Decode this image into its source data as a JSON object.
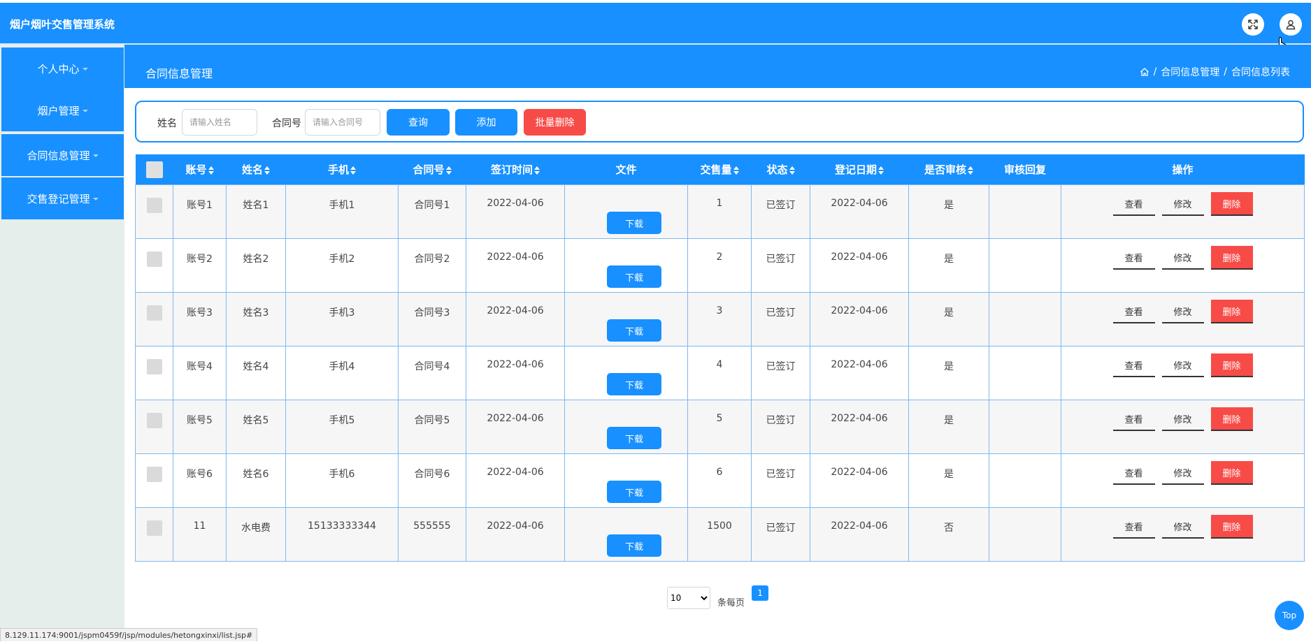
{
  "app": {
    "title": "烟户烟叶交售管理系统"
  },
  "sidebar": {
    "items": [
      {
        "label": "个人中心"
      },
      {
        "label": "烟户管理"
      },
      {
        "label": "合同信息管理"
      },
      {
        "label": "交售登记管理"
      }
    ]
  },
  "header": {
    "title": "合同信息管理",
    "breadcrumb": [
      "合同信息管理",
      "合同信息列表"
    ],
    "breadcrumb_sep": "/"
  },
  "search": {
    "name_label": "姓名",
    "name_placeholder": "请输入姓名",
    "contract_label": "合同号",
    "contract_placeholder": "请输入合同号",
    "query_label": "查询",
    "add_label": "添加",
    "batch_delete_label": "批量删除"
  },
  "table": {
    "columns": [
      "账号",
      "姓名",
      "手机",
      "合同号",
      "签订时间",
      "文件",
      "交售量",
      "状态",
      "登记日期",
      "是否审核",
      "审核回复",
      "操作"
    ],
    "rows": [
      {
        "account": "账号1",
        "name": "姓名1",
        "phone": "手机1",
        "contract": "合同号1",
        "signed": "2022-04-06",
        "file": "下载",
        "qty": "1",
        "status": "已签订",
        "reg_date": "2022-04-06",
        "reviewed": "是",
        "reply": ""
      },
      {
        "account": "账号2",
        "name": "姓名2",
        "phone": "手机2",
        "contract": "合同号2",
        "signed": "2022-04-06",
        "file": "下载",
        "qty": "2",
        "status": "已签订",
        "reg_date": "2022-04-06",
        "reviewed": "是",
        "reply": ""
      },
      {
        "account": "账号3",
        "name": "姓名3",
        "phone": "手机3",
        "contract": "合同号3",
        "signed": "2022-04-06",
        "file": "下载",
        "qty": "3",
        "status": "已签订",
        "reg_date": "2022-04-06",
        "reviewed": "是",
        "reply": ""
      },
      {
        "account": "账号4",
        "name": "姓名4",
        "phone": "手机4",
        "contract": "合同号4",
        "signed": "2022-04-06",
        "file": "下载",
        "qty": "4",
        "status": "已签订",
        "reg_date": "2022-04-06",
        "reviewed": "是",
        "reply": ""
      },
      {
        "account": "账号5",
        "name": "姓名5",
        "phone": "手机5",
        "contract": "合同号5",
        "signed": "2022-04-06",
        "file": "下载",
        "qty": "5",
        "status": "已签订",
        "reg_date": "2022-04-06",
        "reviewed": "是",
        "reply": ""
      },
      {
        "account": "账号6",
        "name": "姓名6",
        "phone": "手机6",
        "contract": "合同号6",
        "signed": "2022-04-06",
        "file": "下载",
        "qty": "6",
        "status": "已签订",
        "reg_date": "2022-04-06",
        "reviewed": "是",
        "reply": ""
      },
      {
        "account": "11",
        "name": "水电费",
        "phone": "15133333344",
        "contract": "555555",
        "signed": "2022-04-06",
        "file": "下载",
        "qty": "1500",
        "status": "已签订",
        "reg_date": "2022-04-06",
        "reviewed": "否",
        "reply": ""
      }
    ],
    "actions": {
      "view": "查看",
      "edit": "修改",
      "delete": "删除"
    }
  },
  "pagination": {
    "page_size": "10",
    "page_size_options": [
      "10"
    ],
    "per_page_label": "条每页",
    "current_page": "1"
  },
  "top_button": "Top",
  "status_url": "8.129.11.174:9001/jspm0459f/jsp/modules/hetongxinxi/list.jsp#",
  "colors": {
    "primary": "#1890ff",
    "danger": "#f74b47",
    "sidebar_bg": "#e6eeec"
  },
  "icons": {
    "fullscreen": "fullscreen-icon",
    "user": "user-icon",
    "home": "home-icon",
    "cursor": "hand-cursor-icon"
  }
}
